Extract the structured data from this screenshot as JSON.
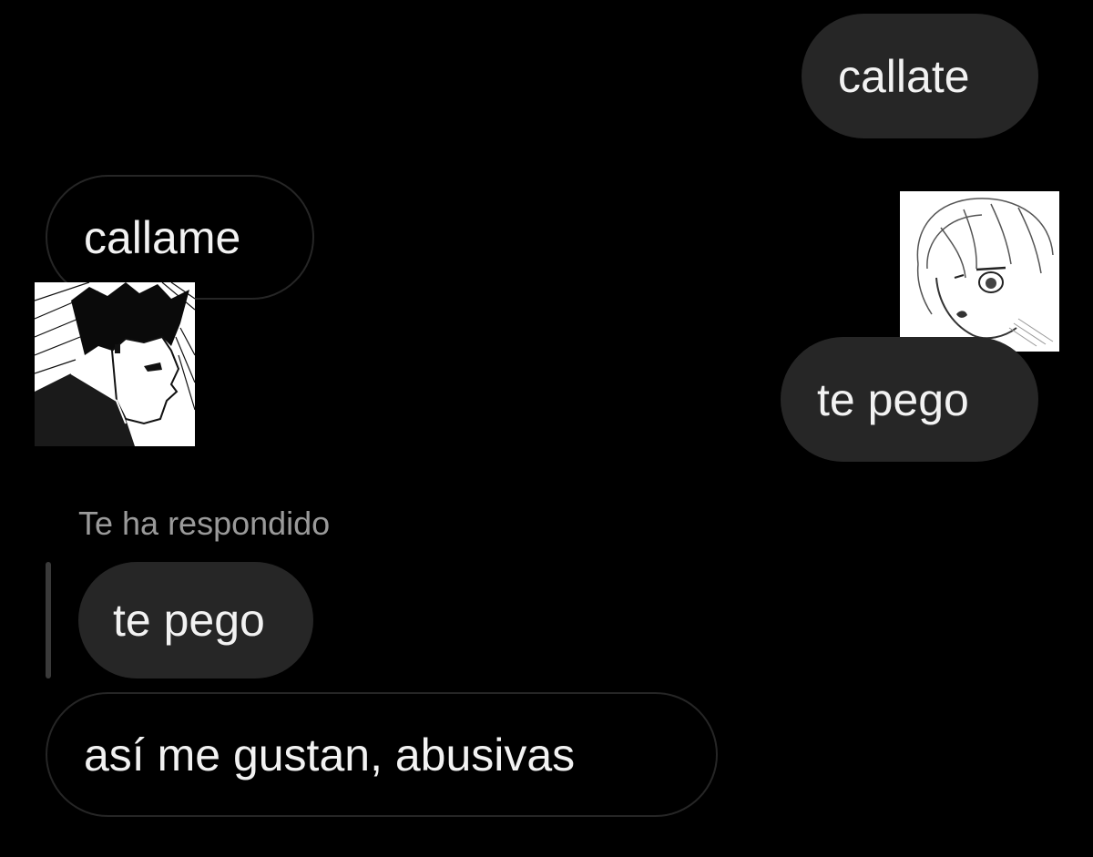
{
  "colors": {
    "background": "#000000",
    "bubble_fill": "#262626",
    "bubble_outline": "#262626",
    "text": "#f2f2f2",
    "reply_label": "#9a9a9a"
  },
  "messages": [
    {
      "id": "msg1",
      "sender": "self",
      "text": "callate"
    },
    {
      "id": "msg2",
      "sender": "other",
      "text": "callame"
    },
    {
      "id": "msg3",
      "sender": "self",
      "text": "te pego"
    },
    {
      "id": "msg4",
      "sender": "other",
      "reply_label": "Te ha respondido",
      "quoted_text": "te pego",
      "text": "así me gustan, abusivas"
    }
  ],
  "stickers": [
    {
      "id": "sticker-left",
      "icon": "manga-boy-profile-sticker"
    },
    {
      "id": "sticker-right",
      "icon": "manga-girl-face-sticker"
    }
  ]
}
